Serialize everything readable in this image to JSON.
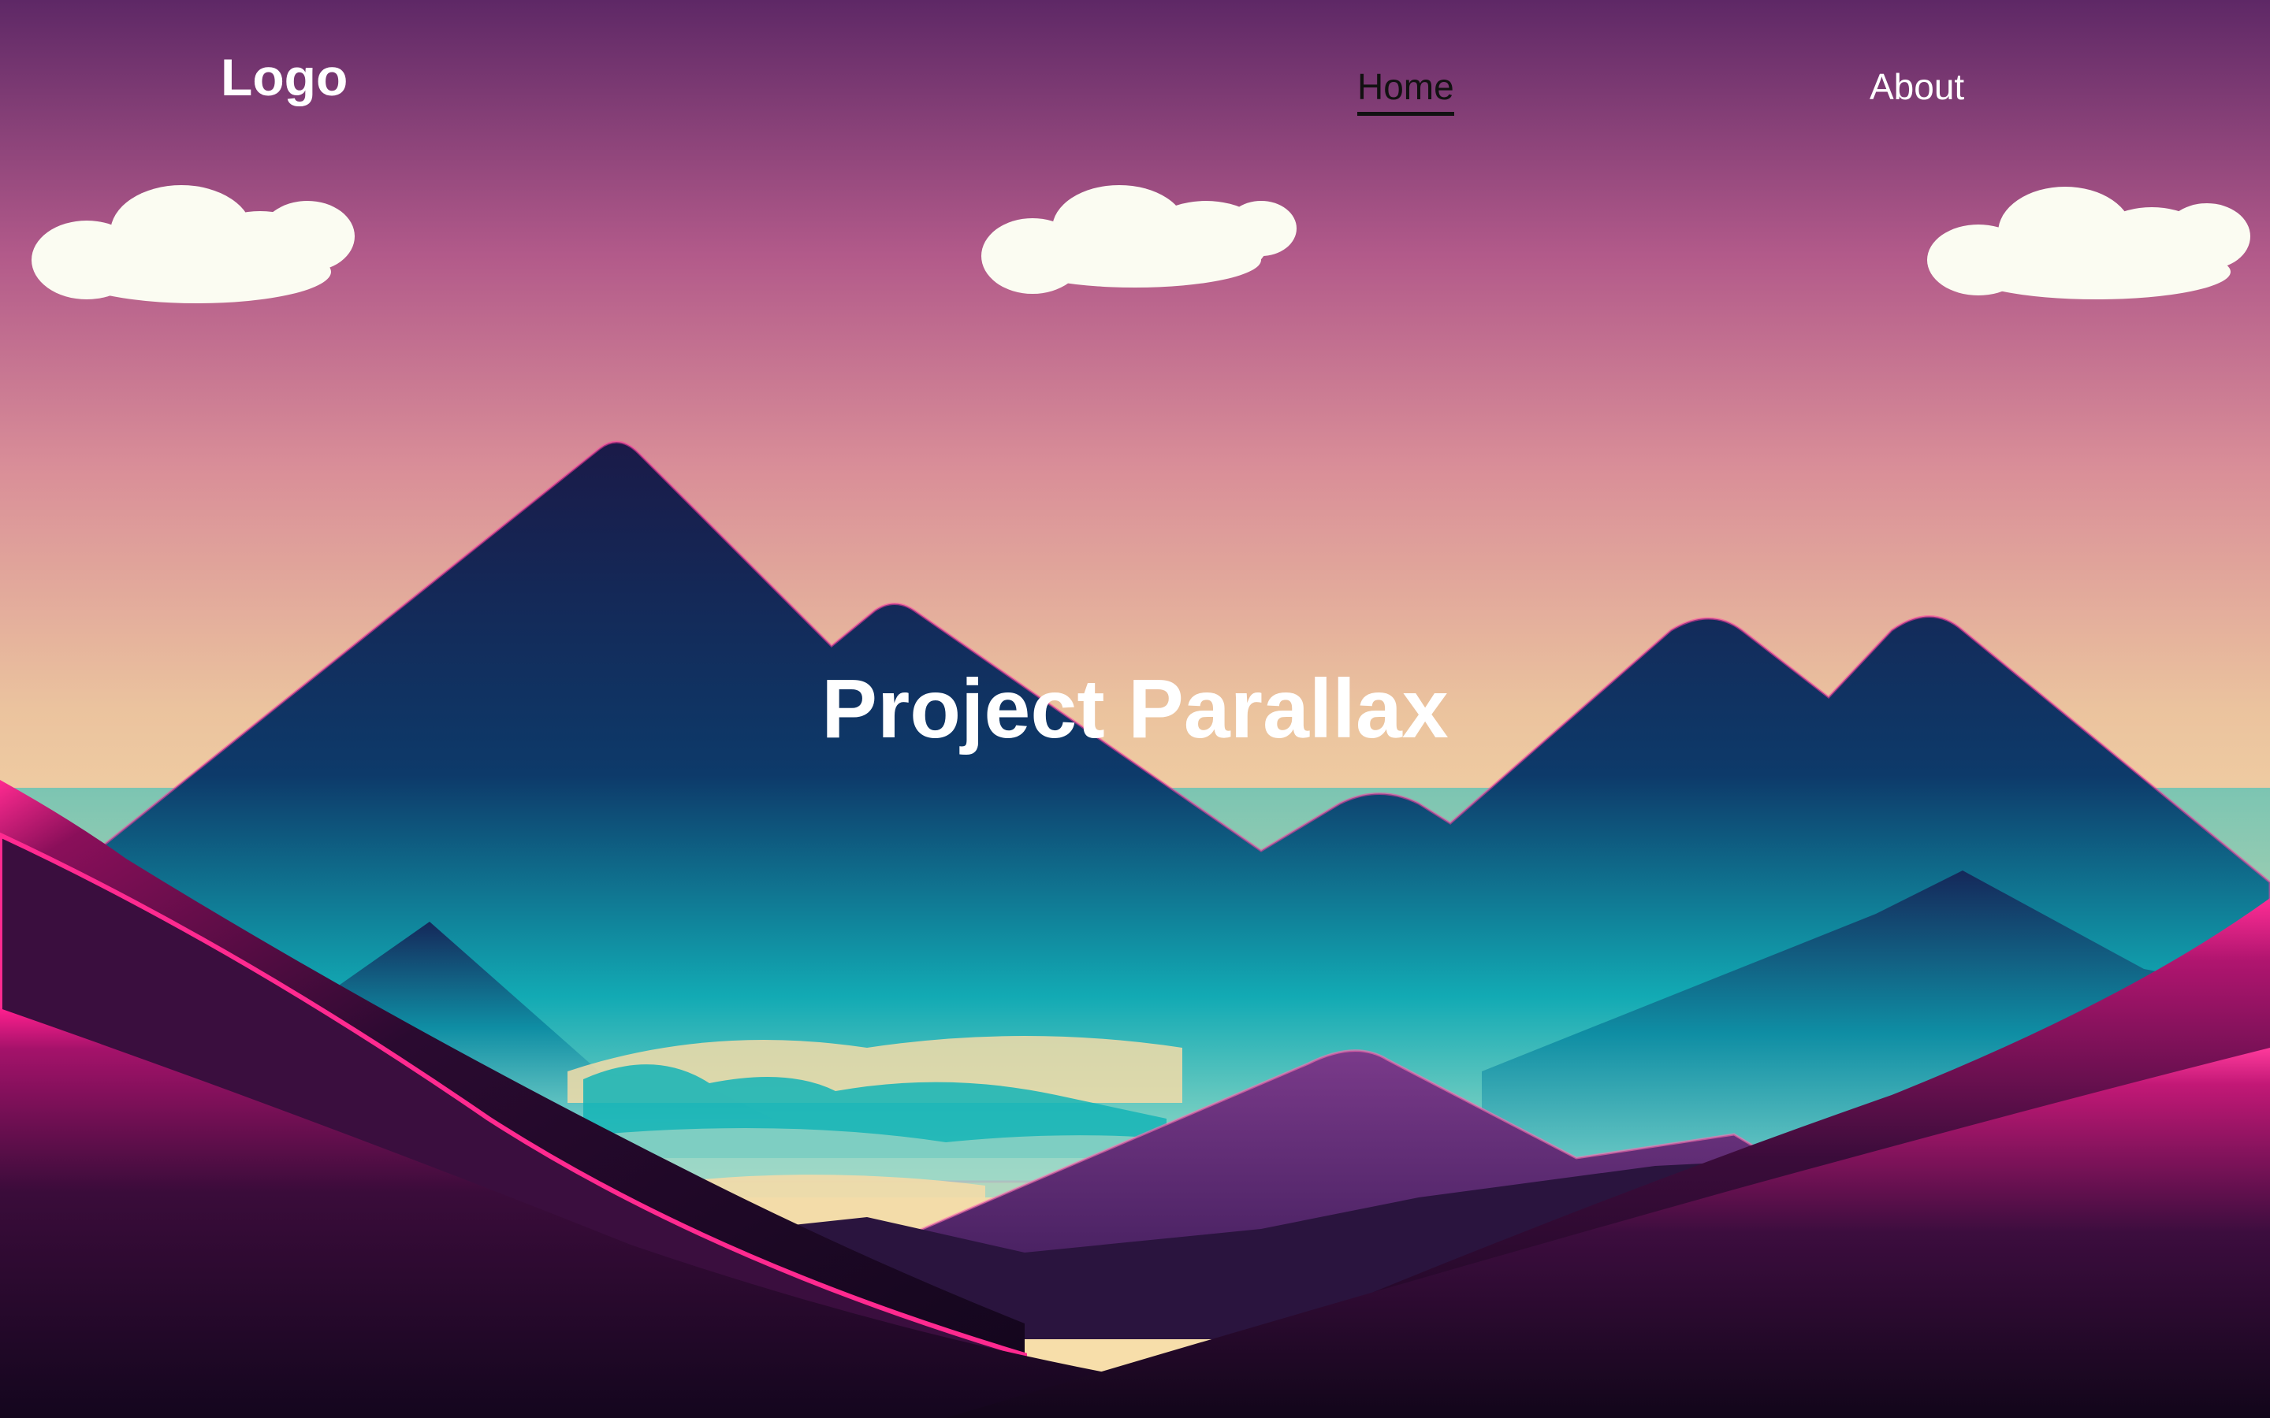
{
  "nav": {
    "logo": "Logo",
    "links": [
      {
        "label": "Home",
        "active": true
      },
      {
        "label": "About",
        "active": false
      }
    ]
  },
  "hero": {
    "title": "Project Parallax"
  },
  "colors": {
    "sky_top": "#6a2a6a",
    "sky_mid": "#cf7a92",
    "sky_bottom": "#f5dca8",
    "mountain_dark": "#102050",
    "mountain_teal": "#13b5b8",
    "hill_magenta": "#ff1a8c",
    "hill_dark": "#1a0a26",
    "cloud": "#fbfcf2"
  }
}
